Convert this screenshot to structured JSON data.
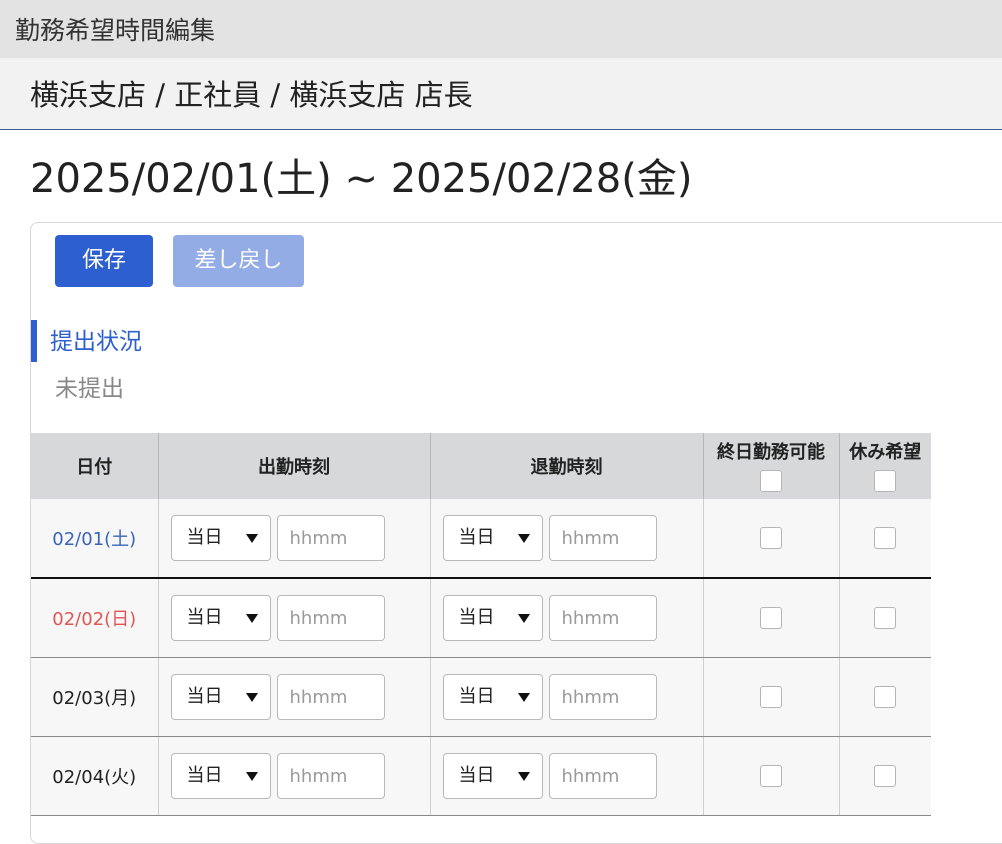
{
  "header": {
    "title": "勤務希望時間編集"
  },
  "breadcrumb": {
    "text": "横浜支店 / 正社員 / 横浜支店 店長"
  },
  "period": {
    "text": "2025/02/01(土) ~ 2025/02/28(金)"
  },
  "toolbar": {
    "save_label": "保存",
    "revert_label": "差し戻し"
  },
  "status": {
    "label": "提出状況",
    "value": "未提出"
  },
  "table": {
    "headers": {
      "date": "日付",
      "start": "出勤時刻",
      "end": "退勤時刻",
      "allday": "終日勤務可能",
      "dayoff": "休み希望"
    },
    "day_option": "当日",
    "time_placeholder": "hhmm",
    "rows": [
      {
        "date": "02/01(土)",
        "color": "#3a64b8"
      },
      {
        "date": "02/02(日)",
        "color": "#e25555"
      },
      {
        "date": "02/03(月)",
        "color": "#222222"
      },
      {
        "date": "02/04(火)",
        "color": "#222222"
      }
    ]
  }
}
